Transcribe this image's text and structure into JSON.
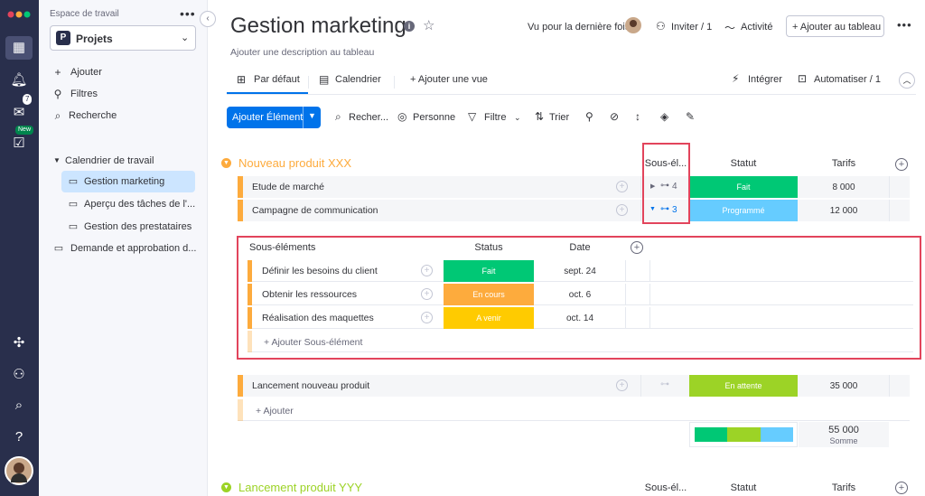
{
  "colors": {
    "accent": "#0073ea",
    "group_orange": "#fdab3d",
    "group_green": "#9cd326",
    "status_done": "#00c875",
    "status_scheduled": "#66ccff",
    "status_in_progress": "#fdab3d",
    "status_upcoming": "#ffcb00",
    "status_waiting": "#9cd326",
    "highlight_red": "#e2445c"
  },
  "rail": {
    "new_badge": "New",
    "inbox_count": "7"
  },
  "sidebar": {
    "workspace_label": "Espace de travail",
    "workspace_name": "Projets",
    "workspace_letter": "P",
    "actions": [
      {
        "label": "Ajouter",
        "icon": "plus-icon"
      },
      {
        "label": "Filtres",
        "icon": "filter-icon"
      },
      {
        "label": "Recherche",
        "icon": "search-icon"
      }
    ],
    "folder": "Calendrier de travail",
    "items": [
      {
        "label": "Gestion marketing"
      },
      {
        "label": "Aperçu des tâches de l'..."
      },
      {
        "label": "Gestion des prestataires"
      },
      {
        "label": "Demande et approbation d..."
      }
    ]
  },
  "header": {
    "title": "Gestion marketing",
    "description": "Ajouter une description au tableau",
    "last_seen": "Vu pour la dernière fois",
    "invite": "Inviter / 1",
    "activity": "Activité",
    "add_to_board": "+ Ajouter au tableau"
  },
  "tabs": {
    "default": "Par défaut",
    "calendar": "Calendrier",
    "add_view": "+ Ajouter une vue",
    "integrate": "Intégrer",
    "automate": "Automatiser / 1"
  },
  "toolbar": {
    "add_item": "Ajouter Élément",
    "search": "Recher...",
    "person": "Personne",
    "filter": "Filtre",
    "sort": "Trier"
  },
  "group1": {
    "title": "Nouveau produit XXX",
    "col_subitems": "Sous-él...",
    "col_status": "Statut",
    "col_price": "Tarifs",
    "rows": [
      {
        "name": "Etude de marché",
        "subitems": "4",
        "status": "Fait",
        "price": "8 000"
      },
      {
        "name": "Campagne de communication",
        "subitems": "3",
        "status": "Programmé",
        "price": "12 000"
      },
      {
        "name": "Lancement nouveau produit",
        "subitems": "",
        "status": "En attente",
        "price": "35 000"
      }
    ],
    "add_row": "+ Ajouter",
    "sum_value": "55 000",
    "sum_label": "Somme",
    "sum_distribution": [
      0.33,
      0.33,
      0.34
    ]
  },
  "subitems": {
    "title": "Sous-éléments",
    "col_status": "Status",
    "col_date": "Date",
    "rows": [
      {
        "name": "Définir les besoins du client",
        "status": "Fait",
        "date": "sept. 24"
      },
      {
        "name": "Obtenir les ressources",
        "status": "En cours",
        "date": "oct. 6"
      },
      {
        "name": "Réalisation des maquettes",
        "status": "A venir",
        "date": "oct. 14"
      }
    ],
    "add_row": "+ Ajouter Sous-élément"
  },
  "group2": {
    "title": "Lancement produit YYY",
    "col_subitems": "Sous-él...",
    "col_status": "Statut",
    "col_price": "Tarifs"
  }
}
